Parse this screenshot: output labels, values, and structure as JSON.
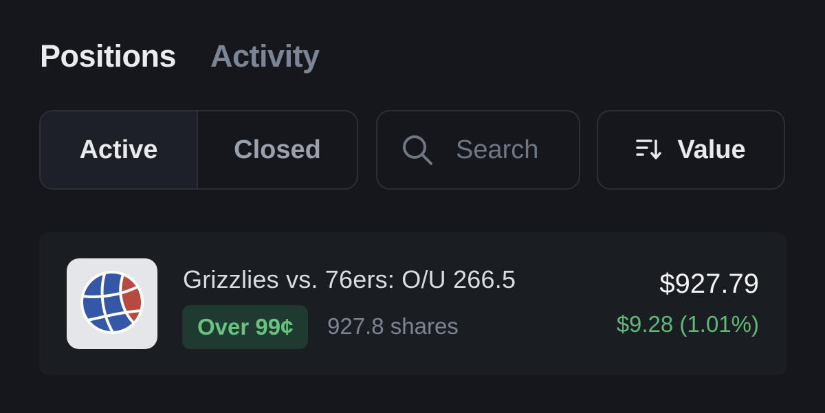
{
  "tabs": [
    {
      "label": "Positions",
      "active": true
    },
    {
      "label": "Activity",
      "active": false
    }
  ],
  "filter": {
    "options": [
      {
        "label": "Active",
        "selected": true
      },
      {
        "label": "Closed",
        "selected": false
      }
    ]
  },
  "search": {
    "icon": "search-icon",
    "placeholder": "Search",
    "value": ""
  },
  "sort": {
    "icon": "sort-descending-icon",
    "label": "Value"
  },
  "positions": [
    {
      "icon": "basketball-icon",
      "title": "Grizzlies vs. 76ers: O/U 266.5",
      "outcome": "Over 99¢",
      "shares": "927.8 shares",
      "value": "$927.79",
      "pnl": "$9.28 (1.01%)"
    }
  ],
  "colors": {
    "background": "#15171c",
    "positive": "#5dbb75",
    "badge_bg": "#1f3a30"
  }
}
